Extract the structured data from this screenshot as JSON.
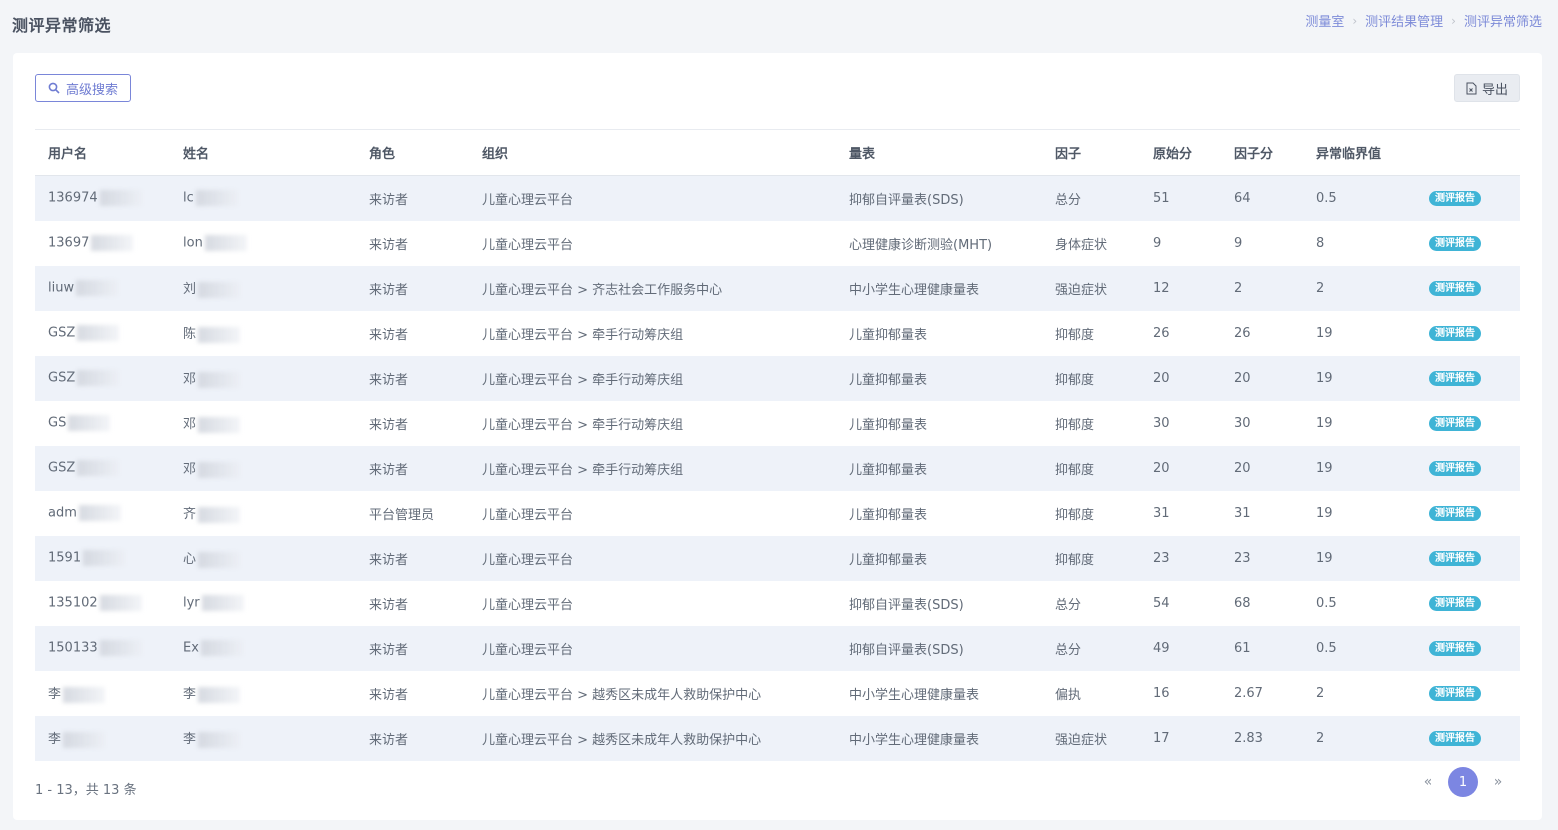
{
  "page": {
    "title": "测评异常筛选",
    "breadcrumb": [
      "测量室",
      "测评结果管理",
      "测评异常筛选"
    ]
  },
  "toolbar": {
    "search_label": "高级搜索",
    "export_label": "导出"
  },
  "table": {
    "columns": [
      "用户名",
      "姓名",
      "角色",
      "组织",
      "量表",
      "因子",
      "原始分",
      "因子分",
      "异常临界值",
      ""
    ],
    "rows": [
      [
        "136974",
        "lc",
        "来访者",
        "儿童心理云平台",
        "抑郁自评量表(SDS)",
        "总分",
        "51",
        "64",
        "0.5",
        "测评报告"
      ],
      [
        "13697",
        "lon",
        "来访者",
        "儿童心理云平台",
        "心理健康诊断测验(MHT)",
        "身体症状",
        "9",
        "9",
        "8",
        "测评报告"
      ],
      [
        "liuw",
        "刘",
        "来访者",
        "儿童心理云平台 > 齐志社会工作服务中心",
        "中小学生心理健康量表",
        "强迫症状",
        "12",
        "2",
        "2",
        "测评报告"
      ],
      [
        "GSZ",
        "陈",
        "来访者",
        "儿童心理云平台 > 牵手行动筹庆组",
        "儿童抑郁量表",
        "抑郁度",
        "26",
        "26",
        "19",
        "测评报告"
      ],
      [
        "GSZ",
        "邓",
        "来访者",
        "儿童心理云平台 > 牵手行动筹庆组",
        "儿童抑郁量表",
        "抑郁度",
        "20",
        "20",
        "19",
        "测评报告"
      ],
      [
        "GS",
        "邓",
        "来访者",
        "儿童心理云平台 > 牵手行动筹庆组",
        "儿童抑郁量表",
        "抑郁度",
        "30",
        "30",
        "19",
        "测评报告"
      ],
      [
        "GSZ",
        "邓",
        "来访者",
        "儿童心理云平台 > 牵手行动筹庆组",
        "儿童抑郁量表",
        "抑郁度",
        "20",
        "20",
        "19",
        "测评报告"
      ],
      [
        "adm",
        "齐",
        "平台管理员",
        "儿童心理云平台",
        "儿童抑郁量表",
        "抑郁度",
        "31",
        "31",
        "19",
        "测评报告"
      ],
      [
        "1591",
        "心",
        "来访者",
        "儿童心理云平台",
        "儿童抑郁量表",
        "抑郁度",
        "23",
        "23",
        "19",
        "测评报告"
      ],
      [
        "135102",
        "lyr",
        "来访者",
        "儿童心理云平台",
        "抑郁自评量表(SDS)",
        "总分",
        "54",
        "68",
        "0.5",
        "测评报告"
      ],
      [
        "150133",
        "Ex",
        "来访者",
        "儿童心理云平台",
        "抑郁自评量表(SDS)",
        "总分",
        "49",
        "61",
        "0.5",
        "测评报告"
      ],
      [
        "李",
        "李",
        "来访者",
        "儿童心理云平台 > 越秀区未成年人救助保护中心",
        "中小学生心理健康量表",
        "偏执",
        "16",
        "2.67",
        "2",
        "测评报告"
      ],
      [
        "李",
        "李",
        "来访者",
        "儿童心理云平台 > 越秀区未成年人救助保护中心",
        "中小学生心理健康量表",
        "强迫症状",
        "17",
        "2.83",
        "2",
        "测评报告"
      ]
    ]
  },
  "footer": {
    "summary": "1 - 13，共 13 条",
    "current_page": "1",
    "prev": "«",
    "next": "»"
  },
  "colors": {
    "accent": "#7c86e2",
    "badge": "#3fb4d6",
    "row_stripe": "#eef2f9"
  }
}
